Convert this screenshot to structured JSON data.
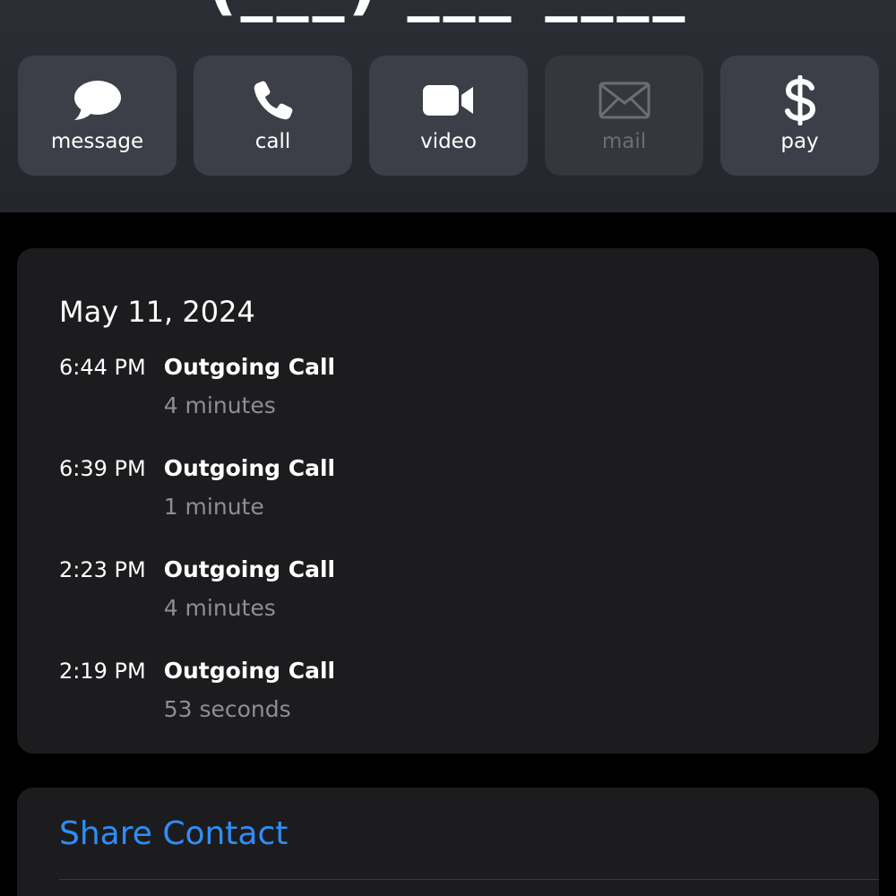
{
  "header": {
    "title": "(___) ___-____"
  },
  "actions": [
    {
      "label": "message",
      "icon": "message-bubble-icon",
      "enabled": true
    },
    {
      "label": "call",
      "icon": "phone-icon",
      "enabled": true
    },
    {
      "label": "video",
      "icon": "video-camera-icon",
      "enabled": true
    },
    {
      "label": "mail",
      "icon": "envelope-icon",
      "enabled": false
    },
    {
      "label": "pay",
      "icon": "dollar-icon",
      "enabled": true
    }
  ],
  "recents": {
    "date": "May 11, 2024",
    "calls": [
      {
        "time": "6:44 PM",
        "type": "Outgoing Call",
        "duration": "4 minutes"
      },
      {
        "time": "6:39 PM",
        "type": "Outgoing Call",
        "duration": "1 minute"
      },
      {
        "time": "2:23 PM",
        "type": "Outgoing Call",
        "duration": "4 minutes"
      },
      {
        "time": "2:19 PM",
        "type": "Outgoing Call",
        "duration": "53 seconds"
      }
    ]
  },
  "share": {
    "label": "Share Contact"
  },
  "colors": {
    "accent": "#2f8ef8",
    "card": "#1c1c1e",
    "header": "#2b2e35",
    "secondary_text": "#8e8e93"
  }
}
